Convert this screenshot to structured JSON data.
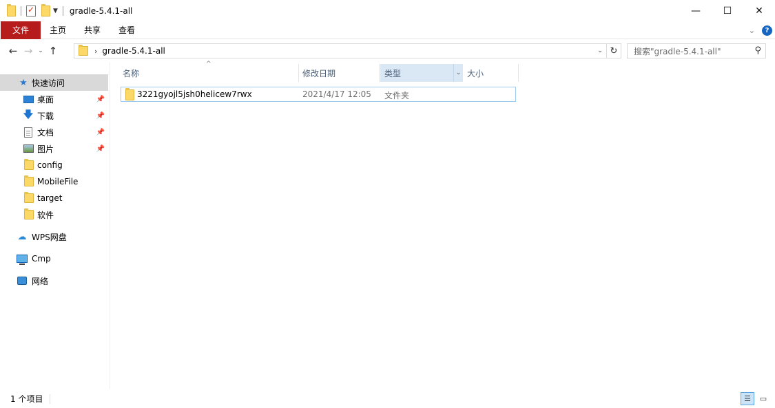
{
  "window": {
    "title": "gradle-5.4.1-all",
    "minimize": "—",
    "maximize": "☐",
    "close": "✕"
  },
  "ribbon": {
    "tabs": [
      "文件",
      "主页",
      "共享",
      "查看"
    ],
    "file_color": "#b71c1c"
  },
  "nav": {
    "back": "←",
    "forward": "→",
    "recent": "⌄",
    "up": "↑",
    "path": "gradle-5.4.1-all",
    "search_placeholder": "搜索\"gradle-5.4.1-all\""
  },
  "sidebar": {
    "items": [
      {
        "label": "快速访问",
        "icon": "star-icon"
      },
      {
        "label": "桌面",
        "icon": "desktop-icon",
        "pinned": true
      },
      {
        "label": "下载",
        "icon": "download-icon",
        "pinned": true
      },
      {
        "label": "文档",
        "icon": "document-icon",
        "pinned": true
      },
      {
        "label": "图片",
        "icon": "picture-icon",
        "pinned": true
      },
      {
        "label": "config",
        "icon": "folder-icon"
      },
      {
        "label": "MobileFile",
        "icon": "folder-icon"
      },
      {
        "label": "target",
        "icon": "folder-icon"
      },
      {
        "label": "软件",
        "icon": "folder-icon"
      },
      {
        "label": "WPS网盘",
        "icon": "cloud-icon"
      },
      {
        "label": "Cmp",
        "icon": "computer-icon"
      },
      {
        "label": "网络",
        "icon": "network-icon"
      }
    ]
  },
  "columns": {
    "name": "名称",
    "modified": "修改日期",
    "type": "类型",
    "size": "大小"
  },
  "files": [
    {
      "name": "3221gyojl5jsh0helicew7rwx",
      "modified": "2021/4/17 12:05",
      "type": "文件夹",
      "size": ""
    }
  ],
  "status": {
    "count": "1 个项目"
  }
}
